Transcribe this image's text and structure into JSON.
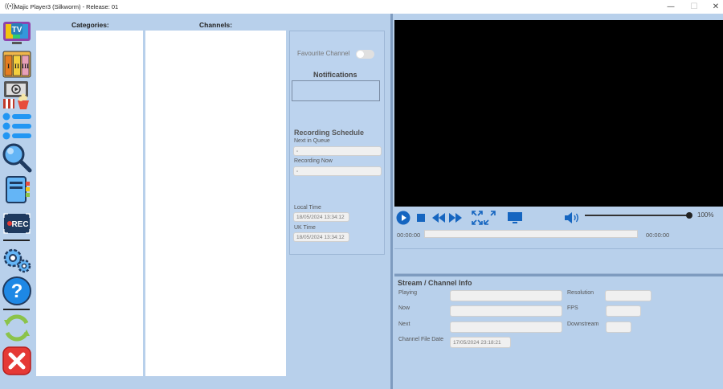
{
  "window": {
    "title": "Majic Player3 (Silkworm) - Release: 01",
    "minimize": "—",
    "maximize": "☐",
    "close": "✕"
  },
  "lists": {
    "categories_header": "Categories:",
    "channels_header": "Channels:"
  },
  "info_panel": {
    "favourite_label": "Favourite Channel",
    "favourite_on": false,
    "notifications_title": "Notifications",
    "recording_title": "Recording Schedule",
    "next_in_queue_label": "Next in Queue",
    "recording_now_label": "Recording Now",
    "local_time_label": "Local Time",
    "local_time_value": "18/05/2024 13:34:12",
    "uk_time_label": "UK Time",
    "uk_time_value": "18/05/2024 13:34:12"
  },
  "player": {
    "volume_percent": "100%",
    "volume_level": 1.0,
    "time_elapsed": "00:00:00",
    "time_total": "00:00:00",
    "progress": 0
  },
  "stream_info": {
    "title": "Stream / Channel Info",
    "playing_label": "Playing",
    "now_label": "Now",
    "next_label": "Next",
    "channel_file_date_label": "Channel File Date",
    "channel_file_date_value": "17/05/2024 23:18:21",
    "resolution_label": "Resolution",
    "fps_label": "FPS",
    "downstream_label": "Downstream"
  },
  "colors": {
    "accent": "#1565c0",
    "background": "#b8d0eb"
  }
}
